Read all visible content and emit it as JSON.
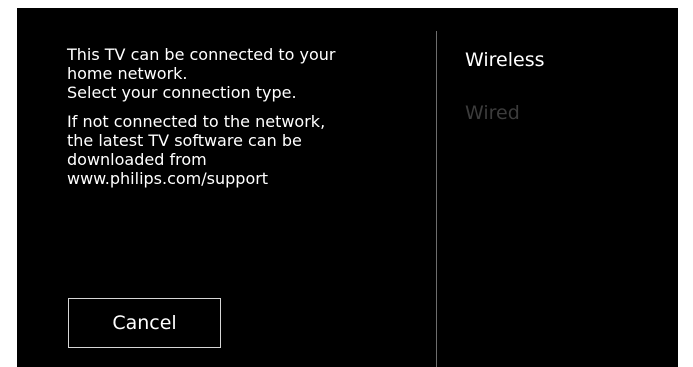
{
  "info": {
    "line1": "This TV can be connected to your",
    "line2": "home network.",
    "line3": "Select your connection type.",
    "line4": "If not connected to the network,",
    "line5": "the latest TV software can be",
    "line6": "downloaded from",
    "line7": "www.philips.com/support"
  },
  "buttons": {
    "cancel_label": "Cancel"
  },
  "connection_options": {
    "wireless_label": "Wireless",
    "wired_label": "Wired",
    "selected": "Wireless"
  },
  "colors": {
    "background": "#000000",
    "text": "#ffffff",
    "inactive_text": "#3c3c3c",
    "divider": "#6d6d6d",
    "button_border": "#d6d6d6"
  }
}
